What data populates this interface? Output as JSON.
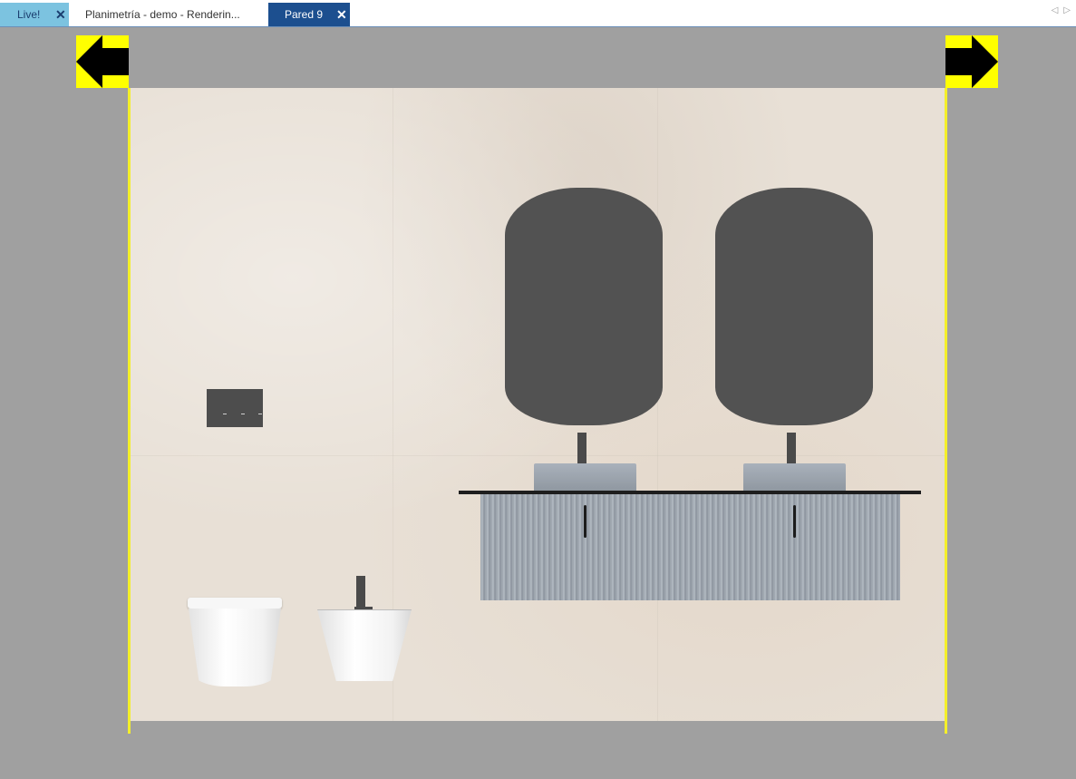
{
  "tabs": [
    {
      "label": "Live!",
      "closable": true,
      "active": false
    },
    {
      "label": "Planimetría - demo - Renderin...",
      "closable": false,
      "active": false
    },
    {
      "label": "Pared 9",
      "closable": true,
      "active": true
    }
  ],
  "close_glyph": "✕",
  "scroll_left_glyph": "◁",
  "scroll_right_glyph": "▷",
  "colors": {
    "active_tab": "#1c4f8f",
    "live_tab": "#7cc3e0",
    "nav_arrow_bg": "#ffff00",
    "wall_edge": "#f4ef2a",
    "background": "#a0a0a0"
  },
  "icons": {
    "previous": "arrow-left-icon",
    "next": "arrow-right-icon"
  }
}
